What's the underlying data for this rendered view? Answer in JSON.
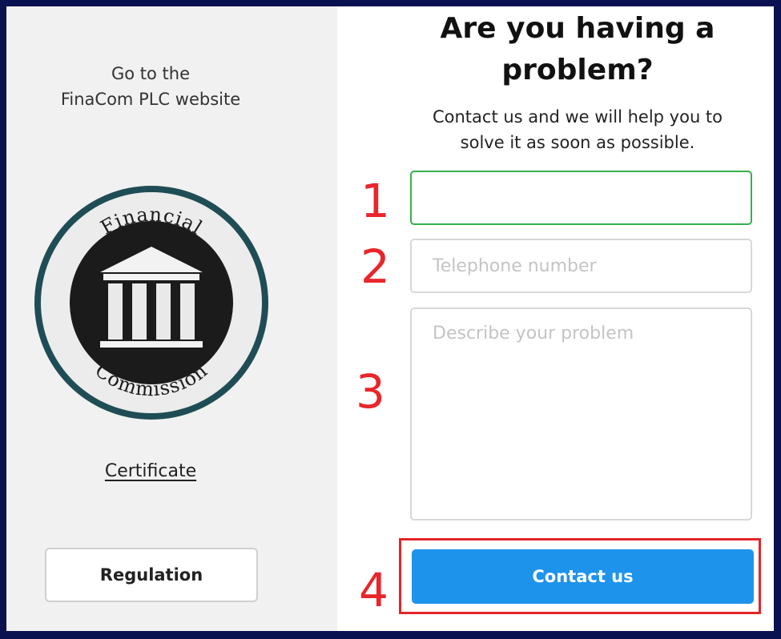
{
  "left_panel": {
    "go_to_line1": "Go to the",
    "go_to_line2": "FinaCom PLC website",
    "seal_top_text": "Financial",
    "seal_bottom_text": "Commission",
    "certificate_link": "Certificate",
    "regulation_button": "Regulation"
  },
  "form": {
    "title_line1": "Are you having a",
    "title_line2": "problem?",
    "subtitle_line1": "Contact us and we will help you to",
    "subtitle_line2": "solve it as soon as possible.",
    "name_value": "",
    "phone_placeholder": "Telephone number",
    "problem_placeholder": "Describe your problem",
    "contact_button": "Contact us"
  },
  "annotations": [
    "1",
    "2",
    "3",
    "4"
  ],
  "colors": {
    "active_border": "#35b04c",
    "button_blue": "#1e93ec",
    "annotation_red": "#e8262b",
    "seal_ring": "#1f4d55"
  }
}
